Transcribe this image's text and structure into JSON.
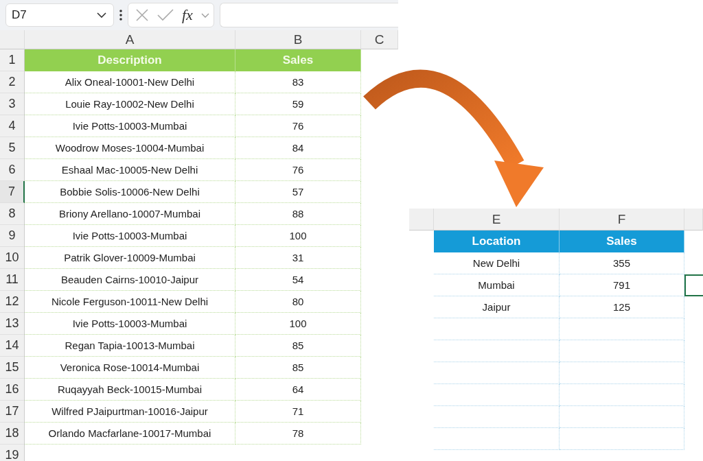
{
  "formula_bar": {
    "name_box": "D7",
    "fx": "fx"
  },
  "left_sheet": {
    "columns": [
      {
        "label": "A"
      },
      {
        "label": "B"
      },
      {
        "label": "C"
      }
    ],
    "header": {
      "number": "1",
      "cells": [
        "Description",
        "Sales"
      ]
    },
    "rows": [
      {
        "number": "2",
        "selected": false,
        "cells": [
          "Alix Oneal-10001-New Delhi",
          "83"
        ]
      },
      {
        "number": "3",
        "selected": false,
        "cells": [
          "Louie Ray-10002-New Delhi",
          "59"
        ]
      },
      {
        "number": "4",
        "selected": false,
        "cells": [
          "Ivie Potts-10003-Mumbai",
          "76"
        ]
      },
      {
        "number": "5",
        "selected": false,
        "cells": [
          "Woodrow Moses-10004-Mumbai",
          "84"
        ]
      },
      {
        "number": "6",
        "selected": false,
        "cells": [
          "Eshaal Mac-10005-New Delhi",
          "76"
        ]
      },
      {
        "number": "7",
        "selected": true,
        "cells": [
          "Bobbie Solis-10006-New Delhi",
          "57"
        ]
      },
      {
        "number": "8",
        "selected": false,
        "cells": [
          "Briony Arellano-10007-Mumbai",
          "88"
        ]
      },
      {
        "number": "9",
        "selected": false,
        "cells": [
          "Ivie Potts-10003-Mumbai",
          "100"
        ]
      },
      {
        "number": "10",
        "selected": false,
        "cells": [
          "Patrik Glover-10009-Mumbai",
          "31"
        ]
      },
      {
        "number": "11",
        "selected": false,
        "cells": [
          "Beauden Cairns-10010-Jaipur",
          "54"
        ]
      },
      {
        "number": "12",
        "selected": false,
        "cells": [
          "Nicole Ferguson-10011-New Delhi",
          "80"
        ]
      },
      {
        "number": "13",
        "selected": false,
        "cells": [
          "Ivie Potts-10003-Mumbai",
          "100"
        ]
      },
      {
        "number": "14",
        "selected": false,
        "cells": [
          "Regan Tapia-10013-Mumbai",
          "85"
        ]
      },
      {
        "number": "15",
        "selected": false,
        "cells": [
          "Veronica Rose-10014-Mumbai",
          "85"
        ]
      },
      {
        "number": "16",
        "selected": false,
        "cells": [
          "Ruqayyah Beck-10015-Mumbai",
          "64"
        ]
      },
      {
        "number": "17",
        "selected": false,
        "cells": [
          "Wilfred PJaipurtman-10016-Jaipur",
          "71"
        ]
      },
      {
        "number": "18",
        "selected": false,
        "cells": [
          "Orlando Macfarlane-10017-Mumbai",
          "78"
        ]
      }
    ],
    "extra_rows": [
      {
        "number": "19"
      }
    ]
  },
  "summary_sheet": {
    "columns": [
      {
        "label": "E"
      },
      {
        "label": "F"
      }
    ],
    "header": [
      "Location",
      "Sales"
    ],
    "rows": [
      {
        "cells": [
          "New Delhi",
          "355"
        ],
        "selected": false
      },
      {
        "cells": [
          "Mumbai",
          "791"
        ],
        "selected": true
      },
      {
        "cells": [
          "Jaipur",
          "125"
        ],
        "selected": false
      }
    ]
  }
}
